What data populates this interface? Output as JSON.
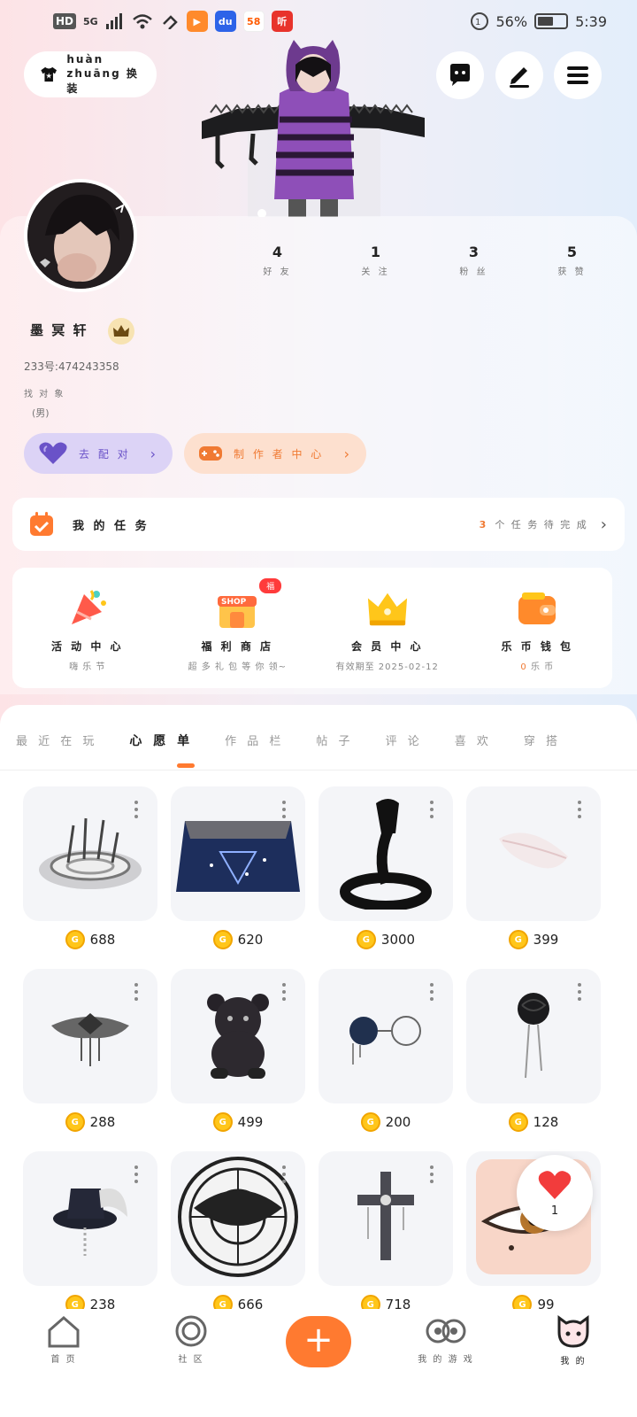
{
  "status_bar": {
    "hd": "HD",
    "network": "5G",
    "app_58": "58",
    "battery": "56%",
    "time": "5:39",
    "battery_level": 0.56
  },
  "header": {
    "outfit_label": "huàn zhuāng 换 装"
  },
  "stats": [
    {
      "value": "4",
      "label": "好 友"
    },
    {
      "value": "1",
      "label": "关 注"
    },
    {
      "value": "3",
      "label": "粉 丝"
    },
    {
      "value": "5",
      "label": "获 赞"
    }
  ],
  "profile": {
    "name": "墨 冥 轩",
    "uid": "233号:474243358",
    "pair_label": "找 对 象",
    "pair_value": "(男)"
  },
  "pills": {
    "match": "去 配 对",
    "creator": "制 作 者 中 心"
  },
  "task": {
    "title": "我 的 任 务",
    "count": "3",
    "pending": "个 任 务 待 完 成"
  },
  "services": [
    {
      "name": "活 动 中 心",
      "sub": "嗨 乐 节"
    },
    {
      "name": "福 利 商 店",
      "sub": "超 多 礼 包 等 你 领~",
      "badge": "福"
    },
    {
      "name": "会 员 中 心",
      "sub": "有效期至 2025-02-12"
    },
    {
      "name": "乐 币 钱 包",
      "sub_count": "0",
      "sub": "乐 币"
    }
  ],
  "tabs": [
    "最 近 在 玩",
    "心 愿 单",
    "作 品 栏",
    "帖 子",
    "评 论",
    "喜 欢",
    "穿 搭"
  ],
  "items": [
    {
      "price": "688",
      "icon": "portal-platform-icon"
    },
    {
      "price": "620",
      "icon": "galaxy-rug-icon"
    },
    {
      "price": "3000",
      "icon": "cobra-icon"
    },
    {
      "price": "399",
      "icon": "feather-icon"
    },
    {
      "price": "288",
      "icon": "tiara-icon"
    },
    {
      "price": "499",
      "icon": "teddy-bear-icon"
    },
    {
      "price": "200",
      "icon": "glasses-icon"
    },
    {
      "price": "128",
      "icon": "black-rose-icon"
    },
    {
      "price": "238",
      "icon": "top-hat-icon"
    },
    {
      "price": "666",
      "icon": "magic-circle-icon"
    },
    {
      "price": "718",
      "icon": "gothic-cross-icon"
    },
    {
      "price": "99",
      "icon": "eye-makeup-icon"
    }
  ],
  "like_count": "1",
  "nav": [
    "首 页",
    "社 区",
    "",
    "我 的 游 戏",
    "我 的"
  ],
  "colors": {
    "accent": "#ff7a30",
    "purple": "#6a52c8",
    "coin": "#ffc61a"
  }
}
